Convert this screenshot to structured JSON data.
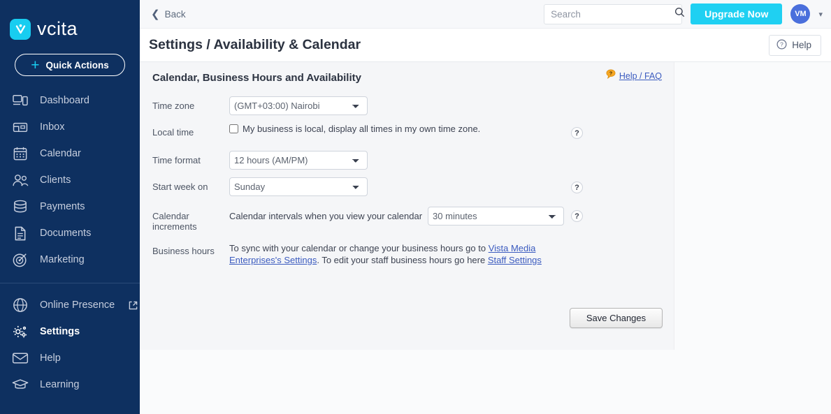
{
  "brand": {
    "name": "vcita",
    "logo_icon": "vcita-logo-icon",
    "accent_color": "#18cdf0",
    "sidebar_color": "#0e3060"
  },
  "sidebar": {
    "quick_actions": {
      "label": "Quick Actions",
      "icon": "plus-icon"
    },
    "items": [
      {
        "label": "Dashboard",
        "icon": "dashboard-icon",
        "active": false
      },
      {
        "label": "Inbox",
        "icon": "inbox-icon",
        "active": false
      },
      {
        "label": "Calendar",
        "icon": "calendar-icon",
        "active": false
      },
      {
        "label": "Clients",
        "icon": "clients-icon",
        "active": false
      },
      {
        "label": "Payments",
        "icon": "payments-icon",
        "active": false
      },
      {
        "label": "Documents",
        "icon": "documents-icon",
        "active": false
      },
      {
        "label": "Marketing",
        "icon": "marketing-icon",
        "active": false
      }
    ],
    "items_secondary": [
      {
        "label": "Online Presence",
        "icon": "globe-icon",
        "external": true,
        "active": false
      },
      {
        "label": "Settings",
        "icon": "gear-icon",
        "external": false,
        "active": true
      },
      {
        "label": "Help",
        "icon": "envelope-icon",
        "external": false,
        "active": false
      },
      {
        "label": "Learning",
        "icon": "graduation-cap-icon",
        "external": false,
        "active": false
      }
    ]
  },
  "topbar": {
    "back_label": "Back",
    "back_icon": "chevron-left-icon",
    "search": {
      "placeholder": "Search",
      "value": "",
      "icon": "search-icon"
    },
    "upgrade_label": "Upgrade Now",
    "upgrade_color": "#1fd0f2",
    "avatar_initials": "VM",
    "avatar_color": "#4a6fdc",
    "caret_icon": "chevron-down-icon"
  },
  "titlebar": {
    "title": "Settings / Availability & Calendar",
    "help_label": "Help",
    "help_icon": "question-circle-icon"
  },
  "card": {
    "title": "Calendar, Business Hours and Availability",
    "help_faq_label": "Help / FAQ",
    "help_faq_icon": "orange-question-bubble-icon"
  },
  "form": {
    "time_zone": {
      "label": "Time zone",
      "value": "(GMT+03:00) Nairobi",
      "options": [
        "(GMT+03:00) Nairobi"
      ]
    },
    "local_time": {
      "label": "Local time",
      "checkbox_label": "My business is local, display all times in my own time zone.",
      "checked": false,
      "help_icon": "question-mark-icon"
    },
    "time_format": {
      "label": "Time format",
      "value": "12 hours (AM/PM)",
      "options": [
        "12 hours (AM/PM)"
      ]
    },
    "start_week_on": {
      "label": "Start week on",
      "value": "Sunday",
      "options": [
        "Sunday"
      ],
      "help_icon": "question-mark-icon"
    },
    "calendar_increments": {
      "label": "Calendar increments",
      "description": "Calendar intervals when you view your calendar",
      "value": "30 minutes",
      "options": [
        "30 minutes"
      ],
      "help_icon": "question-mark-icon"
    },
    "business_hours": {
      "label": "Business hours",
      "text_part1": "To sync with your calendar or change your business hours go to ",
      "link1": "Vista Media Enterprises's Settings",
      "text_part2": ". To edit your staff business hours go here ",
      "link2": "Staff Settings"
    },
    "save_label": "Save Changes"
  },
  "scrollbar": {
    "up_icon": "scroll-up-arrow-icon",
    "down_icon": "scroll-down-arrow-icon"
  }
}
